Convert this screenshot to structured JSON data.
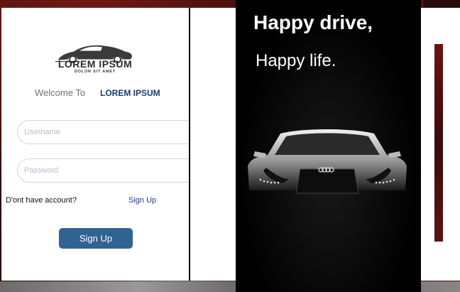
{
  "logo": {
    "icon": "sports-car-icon",
    "title": "LOREM IPSUM",
    "subtitle": "DOLOR SIT AMET"
  },
  "welcome": {
    "text": "Welcome To",
    "brand": "LOREM IPSUM"
  },
  "form": {
    "username_placeholder": "Username",
    "username_value": "",
    "password_placeholder": "Password",
    "password_value": "",
    "no_account_text": "D'ont have account?",
    "signup_link": "Sign Up",
    "signup_button": "Sign Up"
  },
  "promo": {
    "headline": "Happy drive,",
    "subline": "Happy life.",
    "image": "car-front-icon"
  },
  "colors": {
    "button": "#2f6393",
    "brand_text": "#1e3a6e",
    "link": "#1e3a8a",
    "background": "#3b0f0c"
  }
}
